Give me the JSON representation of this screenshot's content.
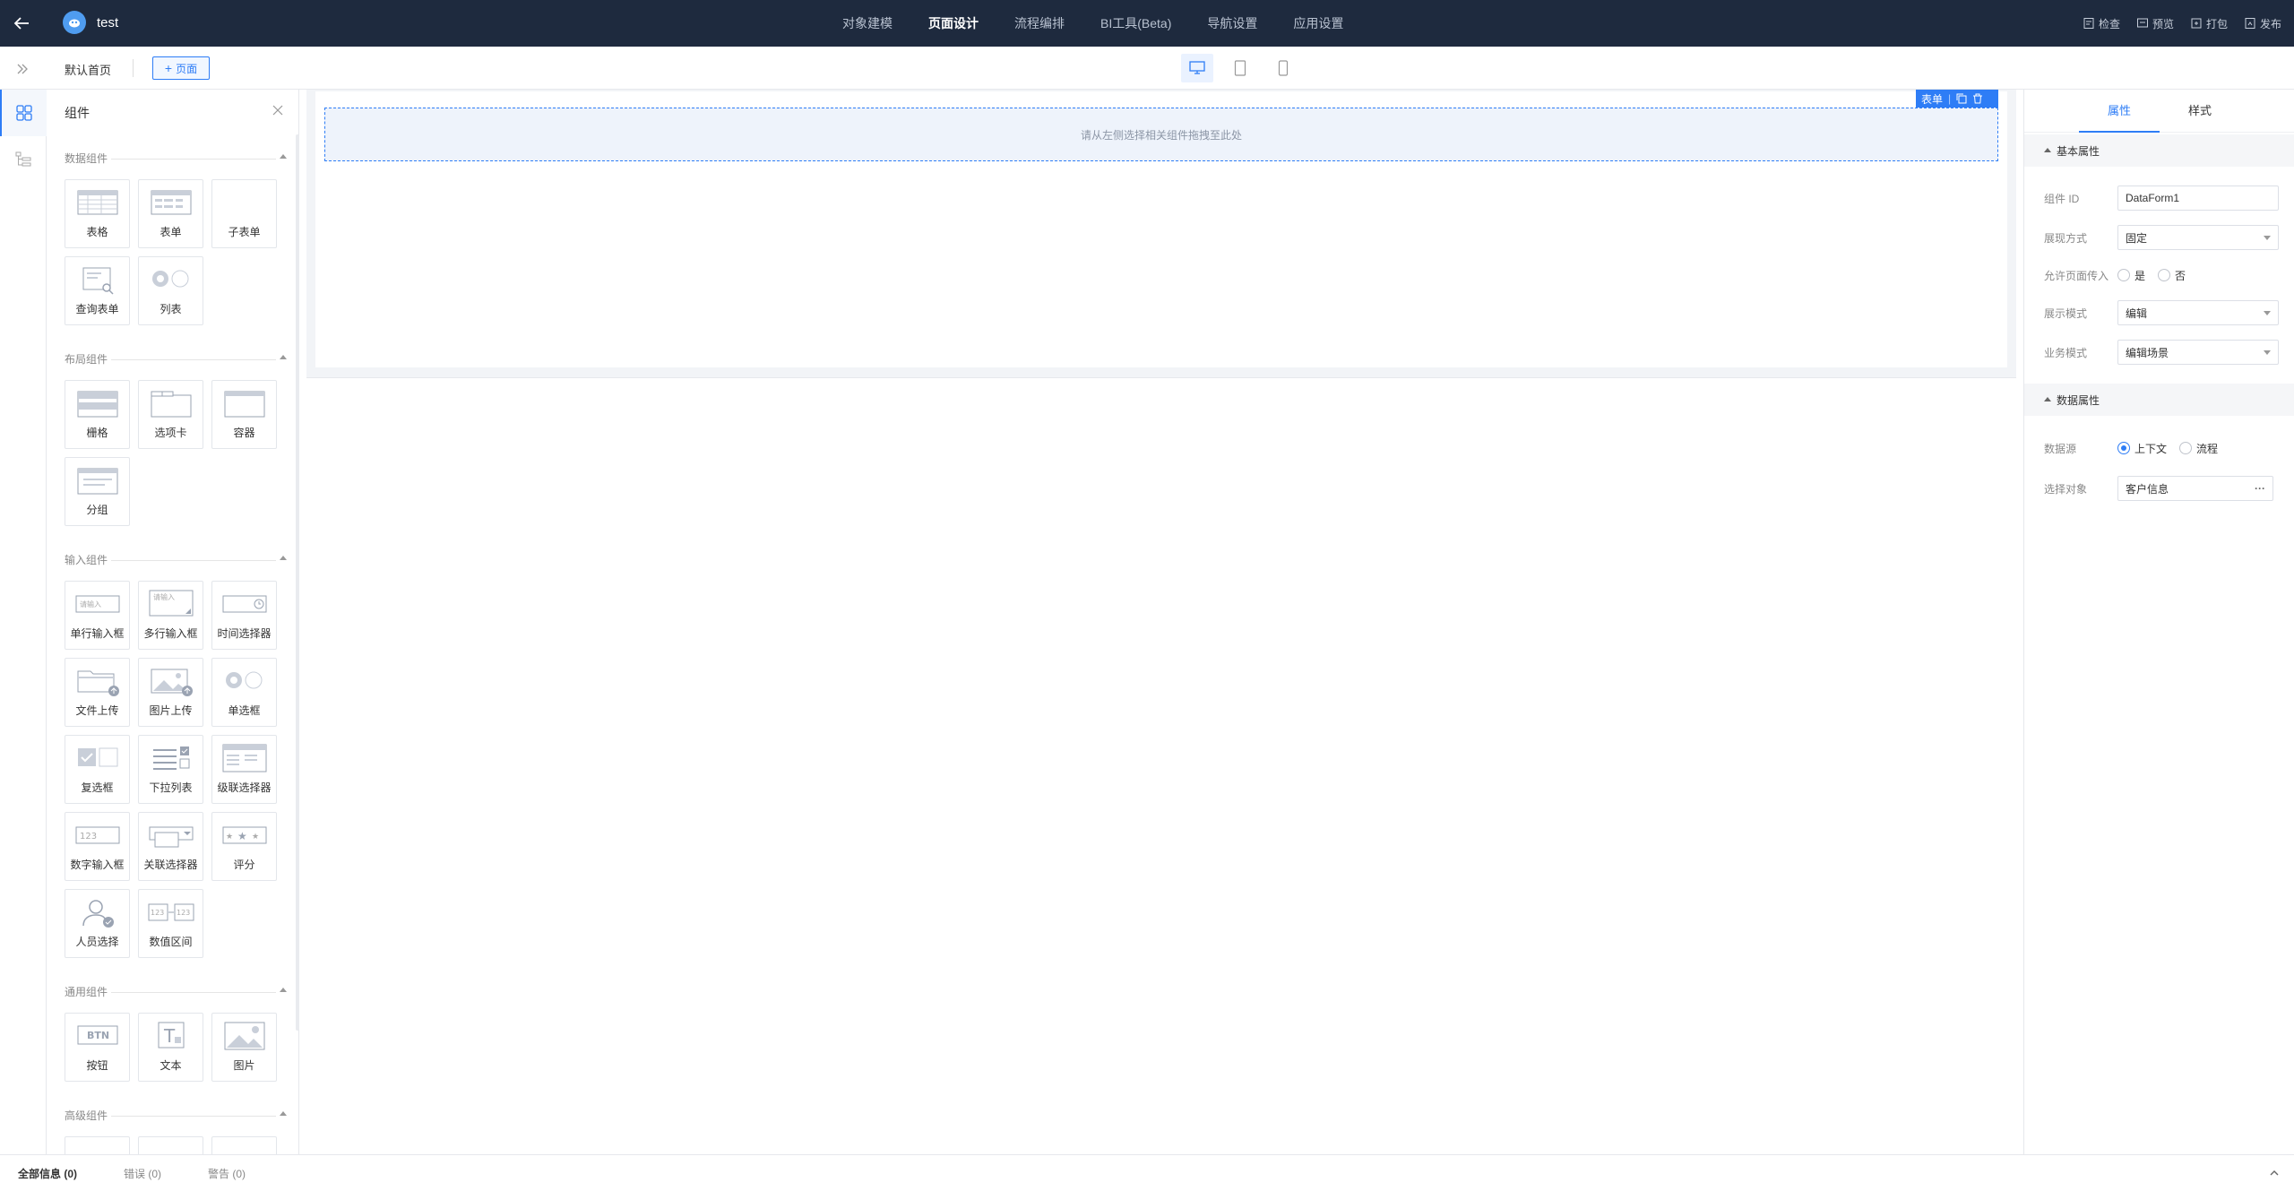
{
  "app": {
    "title": "test"
  },
  "nav": {
    "items": [
      "对象建模",
      "页面设计",
      "流程编排",
      "BI工具(Beta)",
      "导航设置",
      "应用设置"
    ],
    "active_index": 1
  },
  "actions": {
    "check": "检查",
    "preview": "预览",
    "pack": "打包",
    "publish": "发布"
  },
  "toolbar": {
    "page_name": "默认首页",
    "add_page": "页面"
  },
  "components_panel": {
    "title": "组件",
    "categories": [
      {
        "name": "数据组件",
        "items": [
          "表格",
          "表单",
          "子表单",
          "查询表单",
          "列表"
        ]
      },
      {
        "name": "布局组件",
        "items": [
          "栅格",
          "选项卡",
          "容器",
          "分组"
        ]
      },
      {
        "name": "输入组件",
        "items": [
          "单行输入框",
          "多行输入框",
          "时间选择器",
          "文件上传",
          "图片上传",
          "单选框",
          "复选框",
          "下拉列表",
          "级联选择器",
          "数字输入框",
          "关联选择器",
          "评分",
          "人员选择",
          "数值区间"
        ]
      },
      {
        "name": "通用组件",
        "items": [
          "按钮",
          "文本",
          "图片"
        ]
      },
      {
        "name": "高级组件",
        "items": []
      }
    ],
    "icon_text": {
      "input_placeholder": "请输入",
      "number": "123",
      "btn": "BTN",
      "text": "T"
    }
  },
  "canvas": {
    "drop_hint": "请从左侧选择相关组件拖拽至此处",
    "selected_tag": "表单"
  },
  "props_panel": {
    "tabs": [
      "属性",
      "样式"
    ],
    "active_tab": 0,
    "basic_section": "基本属性",
    "component_id_label": "组件 ID",
    "component_id_value": "DataForm1",
    "display_way_label": "展现方式",
    "display_way_value": "固定",
    "allow_pass_label": "允许页面传入",
    "allow_pass_options": [
      "是",
      "否"
    ],
    "allow_pass_selected": null,
    "show_mode_label": "展示模式",
    "show_mode_value": "编辑",
    "biz_mode_label": "业务模式",
    "biz_mode_value": "编辑场景",
    "data_section": "数据属性",
    "datasource_label": "数据源",
    "datasource_options": [
      "上下文",
      "流程"
    ],
    "datasource_selected": 0,
    "select_object_label": "选择对象",
    "select_object_value": "客户信息",
    "more": "···"
  },
  "bottom": {
    "tabs": [
      {
        "label": "全部信息",
        "count": "(0)"
      },
      {
        "label": "错误",
        "count": "(0)"
      },
      {
        "label": "警告",
        "count": "(0)"
      }
    ]
  },
  "colors": {
    "topbar": "#1e2a3e",
    "accent": "#2e7df6"
  }
}
